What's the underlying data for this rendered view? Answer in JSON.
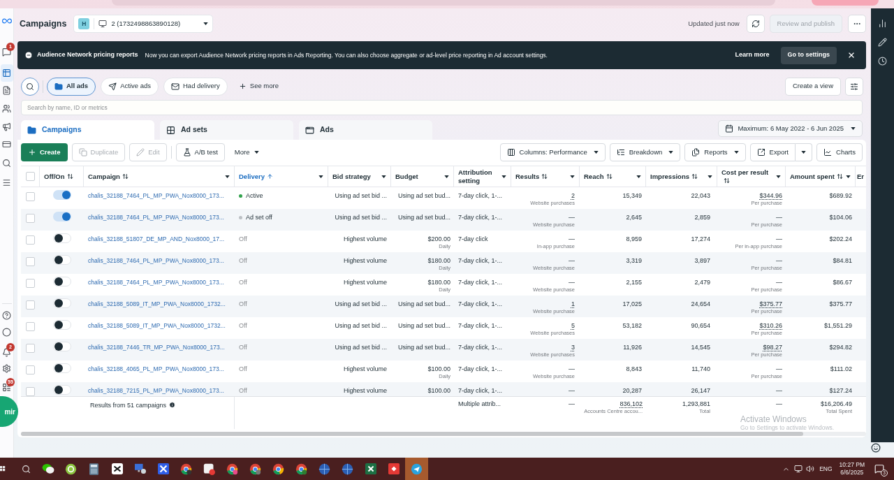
{
  "left_rail": {
    "badges": [
      "1",
      "2",
      "55"
    ],
    "chat_head": "mir"
  },
  "header": {
    "title": "Campaigns",
    "account": {
      "initial": "H",
      "name": "2 (1732498863890128)"
    },
    "status": "Updated just now",
    "publish_button": {
      "label": "Review and publish",
      "disabled": true
    }
  },
  "banner": {
    "title": "Audience Network pricing reports",
    "message": "Now you can export Audience Network pricing reports in Ads Reporting. You can also choose aggregate or ad-level price reporting in Ad account settings.",
    "link": "Learn more",
    "button": "Go to settings"
  },
  "filters": {
    "pills": [
      {
        "label": "All ads",
        "selected": true
      },
      {
        "label": "Active ads",
        "selected": false
      },
      {
        "label": "Had delivery",
        "selected": false
      }
    ],
    "see_more": "See more",
    "create_view": "Create a view"
  },
  "search": {
    "placeholder": "Search by name, ID or metrics"
  },
  "level_tabs": [
    {
      "label": "Campaigns",
      "selected": true
    },
    {
      "label": "Ad sets",
      "selected": false
    },
    {
      "label": "Ads",
      "selected": false
    }
  ],
  "date_range": "Maximum: 6 May 2022 - 6 Jun 2025",
  "toolbar": {
    "actions": [
      {
        "label": "Create",
        "kind": "primary",
        "disabled": false
      },
      {
        "label": "Duplicate",
        "kind": "outline",
        "disabled": true
      },
      {
        "label": "Edit",
        "kind": "outline",
        "disabled": true
      },
      {
        "label": "A/B test",
        "kind": "outline",
        "disabled": false
      },
      {
        "label": "More",
        "kind": "text_menu",
        "disabled": false
      }
    ],
    "view_actions": [
      {
        "label": "Columns: Performance",
        "kind": "outline_menu"
      },
      {
        "label": "Breakdown",
        "kind": "outline_menu"
      },
      {
        "label": "Reports",
        "kind": "outline_menu"
      },
      {
        "label": "Export",
        "kind": "split"
      },
      {
        "label": "Charts",
        "kind": "outline"
      }
    ]
  },
  "table": {
    "all_selected": false,
    "columns": [
      {
        "label": "Off/On",
        "sortable": true,
        "sorted": false,
        "menu": false
      },
      {
        "label": "Campaign",
        "sortable": true,
        "sorted": false,
        "menu": true
      },
      {
        "label": "Delivery",
        "sortable": true,
        "sorted": true,
        "menu": true
      },
      {
        "label": "Bid strategy",
        "sortable": false,
        "sorted": false,
        "menu": true
      },
      {
        "label": "Budget",
        "sortable": false,
        "sorted": false,
        "menu": true
      },
      {
        "label": "Attribution setting",
        "sortable": false,
        "sorted": false,
        "menu": true
      },
      {
        "label": "Results",
        "sortable": true,
        "sorted": false,
        "menu": true
      },
      {
        "label": "Reach",
        "sortable": true,
        "sorted": false,
        "menu": true
      },
      {
        "label": "Impressions",
        "sortable": true,
        "sorted": false,
        "menu": true
      },
      {
        "label": "Cost per result",
        "sortable": true,
        "sorted": false,
        "menu": true
      },
      {
        "label": "Amount spent",
        "sortable": true,
        "sorted": false,
        "menu": true
      },
      {
        "label": "Er"
      }
    ],
    "rows": [
      {
        "selected": false,
        "on": true,
        "campaign": "chalis_32188_7464_PL_MP_PWA_Nox8000_173...",
        "delivery": {
          "label": "Active",
          "color": "#31a24c"
        },
        "bid_strategy": "Using ad set bid ...",
        "budget": {
          "value": "Using ad set bud..."
        },
        "attribution": "7-day click, 1-...",
        "results": {
          "value": "2",
          "type": "Website purchases",
          "linked": true
        },
        "reach": "15,349",
        "impressions": "22,043",
        "cost_per_result": {
          "value": "$344.96",
          "type": "Per purchase",
          "linked": true
        },
        "amount_spent": "$689.92"
      },
      {
        "selected": false,
        "on": true,
        "campaign": "chalis_32188_7464_PL_MP_PWA_Nox8000_173...",
        "delivery": {
          "label": "Ad set off",
          "color": "#bcc0c4"
        },
        "bid_strategy": "Using ad set bid ...",
        "budget": {
          "value": "Using ad set bud..."
        },
        "attribution": "7-day click, 1-...",
        "results": {
          "value": "—",
          "type": "Website purchase",
          "linked": false
        },
        "reach": "2,645",
        "impressions": "2,859",
        "cost_per_result": {
          "value": "—",
          "type": "Per purchase",
          "linked": false
        },
        "amount_spent": "$104.06"
      },
      {
        "selected": false,
        "on": false,
        "campaign": "chalis_32188_51807_DE_MP_AND_Nox8000_17...",
        "delivery": {
          "label": "Off"
        },
        "bid_strategy": "Highest volume",
        "budget": {
          "value": "$200.00",
          "period": "Daily"
        },
        "attribution": "7-day click",
        "results": {
          "value": "—",
          "type": "In-app purchase",
          "linked": false
        },
        "reach": "8,959",
        "impressions": "17,274",
        "cost_per_result": {
          "value": "—",
          "type": "Per in-app purchase",
          "linked": false
        },
        "amount_spent": "$202.24"
      },
      {
        "selected": false,
        "on": false,
        "campaign": "chalis_32188_7464_PL_MP_PWA_Nox8000_173...",
        "delivery": {
          "label": "Off"
        },
        "bid_strategy": "Highest volume",
        "budget": {
          "value": "$180.00",
          "period": "Daily"
        },
        "attribution": "7-day click, 1-...",
        "results": {
          "value": "—",
          "type": "Website purchase",
          "linked": false
        },
        "reach": "3,319",
        "impressions": "3,897",
        "cost_per_result": {
          "value": "—",
          "type": "Per purchase",
          "linked": false
        },
        "amount_spent": "$84.81"
      },
      {
        "selected": false,
        "on": false,
        "campaign": "chalis_32188_7464_PL_MP_PWA_Nox8000_173...",
        "delivery": {
          "label": "Off"
        },
        "bid_strategy": "Highest volume",
        "budget": {
          "value": "$180.00",
          "period": "Daily"
        },
        "attribution": "7-day click, 1-...",
        "results": {
          "value": "—",
          "type": "Website purchase",
          "linked": false
        },
        "reach": "2,155",
        "impressions": "2,479",
        "cost_per_result": {
          "value": "—",
          "type": "Per purchase",
          "linked": false
        },
        "amount_spent": "$86.67"
      },
      {
        "selected": false,
        "on": false,
        "campaign": "chalis_32188_5089_IT_MP_PWA_Nox8000_1732...",
        "delivery": {
          "label": "Off"
        },
        "bid_strategy": "Using ad set bid ...",
        "budget": {
          "value": "Using ad set bud..."
        },
        "attribution": "7-day click, 1-...",
        "results": {
          "value": "1",
          "type": "Website purchase",
          "linked": true
        },
        "reach": "17,025",
        "impressions": "24,654",
        "cost_per_result": {
          "value": "$375.77",
          "type": "Per purchase",
          "linked": true
        },
        "amount_spent": "$375.77"
      },
      {
        "selected": false,
        "on": false,
        "campaign": "chalis_32188_5089_IT_MP_PWA_Nox8000_1732...",
        "delivery": {
          "label": "Off"
        },
        "bid_strategy": "Using ad set bid ...",
        "budget": {
          "value": "Using ad set bud..."
        },
        "attribution": "7-day click, 1-...",
        "results": {
          "value": "5",
          "type": "Website purchases",
          "linked": true
        },
        "reach": "53,182",
        "impressions": "90,654",
        "cost_per_result": {
          "value": "$310.26",
          "type": "Per purchase",
          "linked": true
        },
        "amount_spent": "$1,551.29"
      },
      {
        "selected": false,
        "on": false,
        "campaign": "chalis_32188_7446_TR_MP_PWA_Nox8000_173...",
        "delivery": {
          "label": "Off"
        },
        "bid_strategy": "Using ad set bid ...",
        "budget": {
          "value": "Using ad set bud..."
        },
        "attribution": "7-day click, 1-...",
        "results": {
          "value": "3",
          "type": "Website purchases",
          "linked": true
        },
        "reach": "11,926",
        "impressions": "14,545",
        "cost_per_result": {
          "value": "$98.27",
          "type": "Per purchase",
          "linked": true
        },
        "amount_spent": "$294.82"
      },
      {
        "selected": false,
        "on": false,
        "campaign": "chalis_32188_4065_PL_MP_PWA_Nox8000_173...",
        "delivery": {
          "label": "Off"
        },
        "bid_strategy": "Highest volume",
        "budget": {
          "value": "$100.00",
          "period": "Daily"
        },
        "attribution": "7-day click, 1-...",
        "results": {
          "value": "—",
          "type": "Website purchase",
          "linked": false
        },
        "reach": "8,843",
        "impressions": "11,740",
        "cost_per_result": {
          "value": "—",
          "type": "Per purchase",
          "linked": false
        },
        "amount_spent": "$111.02"
      },
      {
        "selected": false,
        "on": false,
        "campaign": "chalis_32188_7215_PL_MP_PWA_Nox8000_173...",
        "delivery": {
          "label": "Off"
        },
        "bid_strategy": "Highest volume",
        "budget": {
          "value": "$100.00"
        },
        "attribution": "7-day click, 1-...",
        "results": {
          "value": "—",
          "linked": false
        },
        "reach": "20,287",
        "impressions": "26,147",
        "cost_per_result": {
          "value": "—",
          "linked": false
        },
        "amount_spent": "$127.24"
      }
    ],
    "footer": {
      "summary": "Results from 51 campaigns",
      "attribution": "Multiple attrib...",
      "results": "—",
      "reach": {
        "value": "836,102",
        "note": "Accounts Centre accou..."
      },
      "impressions": {
        "value": "1,293,881",
        "note": "Total"
      },
      "cost_per_result": "—",
      "amount_spent": {
        "value": "$16,206.49",
        "note": "Total Spent"
      }
    }
  },
  "os_notice": {
    "title": "Activate Windows",
    "hint": "Go to Settings to activate Windows."
  },
  "taskbar": {
    "language": "ENG",
    "time": "10:27 PM",
    "date": "6/6/2025",
    "notifications": "3"
  }
}
